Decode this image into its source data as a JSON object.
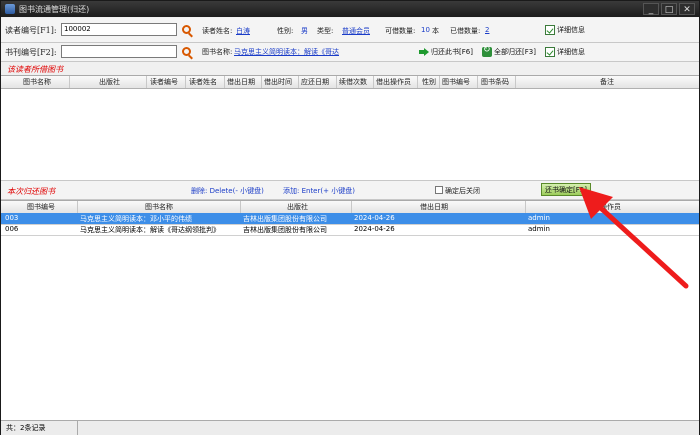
{
  "window": {
    "title": "图书流通管理(归还)",
    "controls": [
      "_",
      "□",
      "✕"
    ]
  },
  "reader_row": {
    "reader_no_label": "读者编号[F1]:",
    "reader_no_value": "100002",
    "reader_name_label": "读者姓名:",
    "reader_name_value": "白涛",
    "gender_label": "性别:",
    "gender_value": "男",
    "type_label": "类型:",
    "type_value": "普通会员",
    "borrowable_label": "可借数量:",
    "borrowable_value": "10",
    "borrowable_unit": "本",
    "borrowed_label": "已借数量:",
    "borrowed_value": "2",
    "details_label": "详细信息"
  },
  "book_row": {
    "book_no_label": "书刊编号[F2]:",
    "book_no_value": "",
    "book_name_label": "图书名称:",
    "book_name_value": "马克思主义简明读本：解读《哥达",
    "return_this_label": "归还此书[F6]",
    "return_all_label": "全部归还[F3]",
    "details_label": "详细信息"
  },
  "borrowed_section": {
    "title": "该读者所借图书",
    "columns": [
      "图书名称",
      "出版社",
      "读者编号",
      "读者姓名",
      "借出日期",
      "借出时间",
      "应还日期",
      "续借次数",
      "借出操作员",
      "性别",
      "图书编号",
      "图书条码",
      "备注"
    ]
  },
  "return_section": {
    "title": "本次归还图书",
    "delete_hint": "删除: Delete(- 小键盘)",
    "add_hint": "添加: Enter(+ 小键盘)",
    "close_after_label": "确定后关闭",
    "confirm_label": "还书确定[F5]",
    "columns": [
      "图书编号",
      "图书名称",
      "出版社",
      "借出日期",
      "操作员"
    ],
    "rows": [
      {
        "id": "003",
        "name": "马克思主义简明读本：邓小平的伟绩",
        "publisher": "吉林出版集团股份有限公司",
        "date": "2024-04-26",
        "operator": "admin",
        "selected": true
      },
      {
        "id": "006",
        "name": "马克思主义简明读本：解读《哥达纲领批判》",
        "publisher": "吉林出版集团股份有限公司",
        "date": "2024-04-26",
        "operator": "admin",
        "selected": false
      }
    ]
  },
  "status_bar": {
    "text": "共：2条记录"
  },
  "colors": {
    "selected_row": "#3d8ee8",
    "section_title": "#e00000",
    "annotation_arrow": "#ee1c1c",
    "link": "#1a3cc8"
  }
}
